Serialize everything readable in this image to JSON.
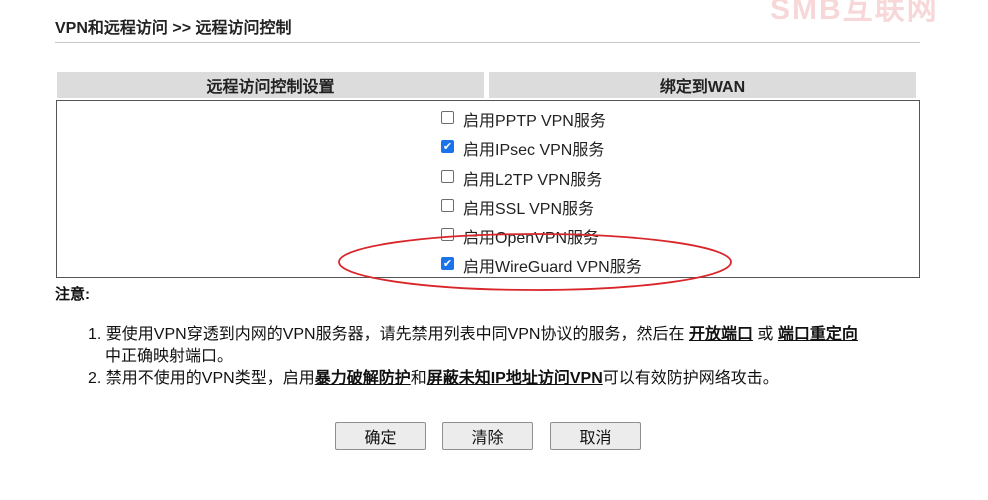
{
  "watermark": "SMB互联网",
  "breadcrumb": "VPN和远程访问 >> 远程访问控制",
  "tabs": {
    "remote_access": "远程访问控制设置",
    "bind_wan": "绑定到WAN"
  },
  "options": [
    {
      "label": "启用PPTP VPN服务",
      "checked": false
    },
    {
      "label": "启用IPsec VPN服务",
      "checked": true
    },
    {
      "label": "启用L2TP VPN服务",
      "checked": false
    },
    {
      "label": "启用SSL VPN服务",
      "checked": false
    },
    {
      "label": "启用OpenVPN服务",
      "checked": false
    },
    {
      "label": "启用WireGuard VPN服务",
      "checked": true
    }
  ],
  "notes": {
    "title": "注意:",
    "item1_text_a": "1. 要使用VPN穿透到内网的VPN服务器，请先禁用列表中同VPN协议的服务，然后在",
    "item1_link1": "开放端口",
    "item1_text_b": "或",
    "item1_link2": "端口重定向",
    "item1_text_c": "中正确映射端口。",
    "item2_text_a": "2. 禁用不使用的VPN类型，启用",
    "item2_link1": "暴力破解防护",
    "item2_text_b": "和",
    "item2_link2": "屏蔽未知IP地址访问VPN",
    "item2_text_c": "可以有效防护网络攻击。"
  },
  "buttons": {
    "ok": "确定",
    "clear": "清除",
    "cancel": "取消"
  },
  "colors": {
    "checkbox_checked": "#1a73e8",
    "annotation": "#d9262b",
    "tab_bg": "#dcdcdc"
  }
}
